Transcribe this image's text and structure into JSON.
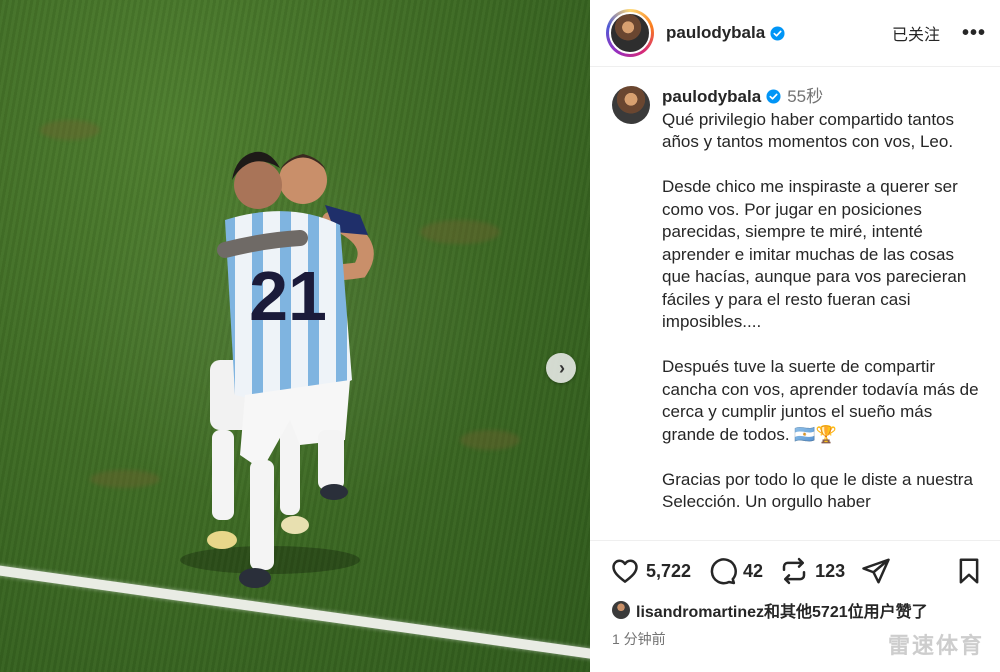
{
  "post": {
    "username": "paulodybala",
    "follow_label": "已关注",
    "more_label": "•••"
  },
  "caption": {
    "username": "paulodybala",
    "time": "55秒",
    "paragraphs": [
      "Qué privilegio haber compartido tantos años y tantos momentos con vos, Leo.",
      "Desde chico me inspiraste a querer ser como vos. Por jugar en posiciones parecidas, siempre te miré, intenté aprender e imitar muchas de las cosas que hacías, aunque para vos parecieran fáciles y para el resto fueran casi imposibles....",
      "Después tuve la suerte de compartir cancha con vos, aprender todavía más de cerca y cumplir juntos el sueño más grande de todos. 🇦🇷🏆",
      "Gracias por todo lo que le diste a nuestra Selección. Un orgullo haber"
    ]
  },
  "photo": {
    "jersey_number": "21"
  },
  "actions": {
    "likes_count": "5,722",
    "comments_count": "42",
    "shares_count": "123"
  },
  "likes_line": "lisandromartinez和其他5721位用户赞了",
  "timestamp": "1 分钟前",
  "watermark": "雷速体育",
  "colors": {
    "pitch": "#3f6c25",
    "verified": "#0095f6",
    "text": "#262626",
    "muted": "#737373"
  }
}
